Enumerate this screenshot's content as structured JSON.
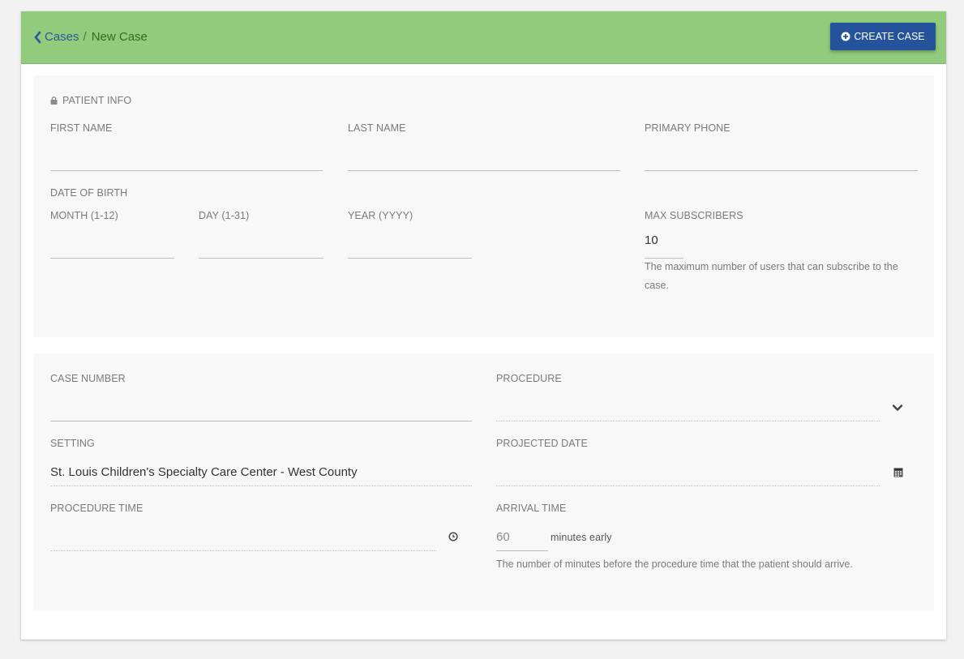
{
  "breadcrumb": {
    "parent": "Cases",
    "separator": "/",
    "current": "New Case"
  },
  "actions": {
    "create_case": "CREATE CASE"
  },
  "patient_info": {
    "section_title": "PATIENT INFO",
    "first_name": {
      "label": "FIRST NAME",
      "value": ""
    },
    "last_name": {
      "label": "LAST NAME",
      "value": ""
    },
    "primary_phone": {
      "label": "PRIMARY PHONE",
      "value": ""
    },
    "date_of_birth": {
      "label": "DATE OF BIRTH",
      "month_label": "MONTH (1-12)",
      "day_label": "DAY (1-31)",
      "year_label": "YEAR (YYYY)"
    },
    "max_subscribers": {
      "label": "MAX SUBSCRIBERS",
      "value": "10",
      "help": "The maximum number of users that can subscribe to the case."
    }
  },
  "case_info": {
    "case_number": {
      "label": "CASE NUMBER",
      "value": ""
    },
    "procedure": {
      "label": "PROCEDURE",
      "value": ""
    },
    "setting": {
      "label": "SETTING",
      "value": "St. Louis Children's Specialty Care Center - West County"
    },
    "projected_date": {
      "label": "PROJECTED DATE",
      "value": ""
    },
    "procedure_time": {
      "label": "PROCEDURE TIME",
      "value": ""
    },
    "arrival_time": {
      "label": "ARRIVAL TIME",
      "value": "60",
      "suffix": "minutes early",
      "help": "The number of minutes before the procedure time that the patient should arrive."
    }
  },
  "icons": {
    "back": "chevron-left-icon",
    "create": "plus-circle-icon",
    "lock": "lock-icon",
    "procedure_dropdown": "chevron-down-icon",
    "date": "calendar-icon",
    "time": "clock-icon"
  },
  "colors": {
    "header_bg": "#92cb7c",
    "button_bg": "#24539b",
    "link": "#2a5a9a",
    "section_bg": "#f8f8f8"
  }
}
